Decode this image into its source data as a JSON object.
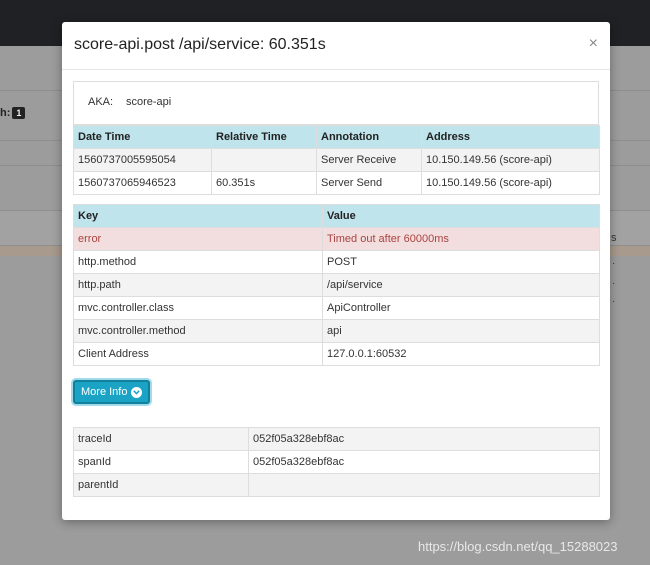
{
  "background": {
    "label": "h:",
    "badge": "1",
    "right_text": "s",
    "watermark": "https://blog.csdn.net/qq_15288023"
  },
  "modal": {
    "title": "score-api.post /api/service: 60.351s",
    "close": "×",
    "aka": {
      "label": "AKA:",
      "value": "score-api"
    },
    "annotations": {
      "headers": [
        "Date Time",
        "Relative Time",
        "Annotation",
        "Address"
      ],
      "rows": [
        [
          "1560737005595054",
          "",
          "Server Receive",
          "10.150.149.56 (score-api)"
        ],
        [
          "1560737065946523",
          "60.351s",
          "Server Send",
          "10.150.149.56 (score-api)"
        ]
      ]
    },
    "tags": {
      "headers": [
        "Key",
        "Value"
      ],
      "rows": [
        [
          "error",
          "Timed out after 60000ms"
        ],
        [
          "http.method",
          "POST"
        ],
        [
          "http.path",
          "/api/service"
        ],
        [
          "mvc.controller.class",
          "ApiController"
        ],
        [
          "mvc.controller.method",
          "api"
        ],
        [
          "Client Address",
          "127.0.0.1:60532"
        ]
      ]
    },
    "more_info_label": "More Info",
    "ids": {
      "rows": [
        [
          "traceId",
          "052f05a328ebf8ac"
        ],
        [
          "spanId",
          "052f05a328ebf8ac"
        ],
        [
          "parentId",
          ""
        ]
      ]
    }
  }
}
